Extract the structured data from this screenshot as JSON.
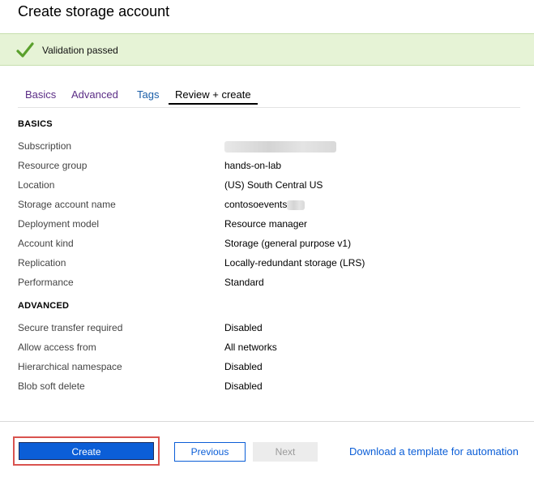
{
  "page": {
    "title": "Create storage account"
  },
  "validation": {
    "text": "Validation passed",
    "icon": "checkmark-icon"
  },
  "tabs": [
    {
      "label": "Basics"
    },
    {
      "label": "Advanced"
    },
    {
      "label": "Tags"
    },
    {
      "label": "Review + create",
      "active": true
    }
  ],
  "basics": {
    "heading": "BASICS",
    "rows": [
      {
        "label": "Subscription",
        "value": "",
        "redacted": true
      },
      {
        "label": "Resource group",
        "value": "hands-on-lab"
      },
      {
        "label": "Location",
        "value": "(US) South Central US"
      },
      {
        "label": "Storage account name",
        "value": "contosoevents",
        "partially_redacted": true
      },
      {
        "label": "Deployment model",
        "value": "Resource manager"
      },
      {
        "label": "Account kind",
        "value": "Storage (general purpose v1)"
      },
      {
        "label": "Replication",
        "value": "Locally-redundant storage (LRS)"
      },
      {
        "label": "Performance",
        "value": "Standard"
      }
    ]
  },
  "advanced": {
    "heading": "ADVANCED",
    "rows": [
      {
        "label": "Secure transfer required",
        "value": "Disabled"
      },
      {
        "label": "Allow access from",
        "value": "All networks"
      },
      {
        "label": "Hierarchical namespace",
        "value": "Disabled"
      },
      {
        "label": "Blob soft delete",
        "value": "Disabled"
      }
    ]
  },
  "footer": {
    "create_label": "Create",
    "previous_label": "Previous",
    "next_label": "Next",
    "download_label": "Download a template for automation"
  },
  "colors": {
    "accent": "#0b5ed7",
    "success_bg": "#e6f3d6",
    "success_icon": "#5aa02c",
    "highlight_box": "#d9534f"
  }
}
